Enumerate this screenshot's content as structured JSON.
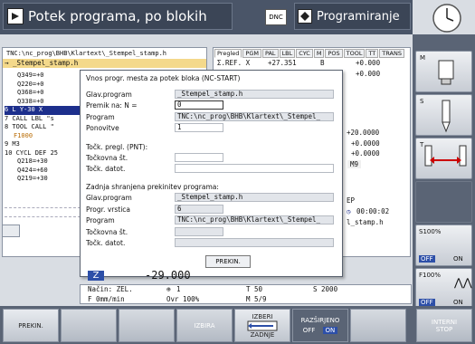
{
  "header": {
    "left_title": "Potek programa, po blokih",
    "dnc_label": "DNC",
    "right_title": "Programiranje"
  },
  "left_panel": {
    "path": "TNC:\\nc_prog\\BHB\\Klartext\\_Stempel_stamp.h",
    "active_file": "→ _Stempel_stamp.h",
    "lines": [
      "Q349=+0",
      "Q220=+0",
      "Q368=+0",
      "Q338=+0",
      "6  L  Y-30  X",
      "7  CALL LBL \"s",
      "8  TOOL CALL \"",
      "F1000",
      "9  M3",
      "10 CYCL DEF 25",
      "Q218=+30",
      "Q424=+60",
      "Q219=+30"
    ]
  },
  "right_panel": {
    "tabs": [
      "Pregled",
      "PGM",
      "PAL",
      "LBL",
      "CYC",
      "M",
      "POS",
      "TOOL",
      "TT",
      "TRANS"
    ],
    "row1": "Σ.REF. X",
    "row1_val": "+27.351",
    "row1_axis": "B",
    "row1_b": "+0.000",
    "row2_b": "+0.000",
    "val_a": "+20.0000",
    "val_b": "+0.0000",
    "val_c": "+0.0000",
    "m9": "M9",
    "time_label": "EP",
    "time": "00:00:02",
    "file": "l_stamp.h"
  },
  "dialog": {
    "title": "Vnos progr. mesta za potek bloka (NC-START)",
    "main_prog_label": "Glav.program",
    "main_prog_value": "_Stempel_stamp.h",
    "jump_label": "Premik na: N =",
    "jump_value": "0",
    "program_label": "Program",
    "program_value": "TNC:\\nc_prog\\BHB\\Klartext\\_Stempel_",
    "repeat_label": "Ponovitve",
    "repeat_value": "1",
    "pnt_heading": "Točk. pregl. (PNT):",
    "point_no_label": "Točkovna št.",
    "point_file_label": "Točk. datot.",
    "saved_heading": "Zadnja shranjena prekinitev programa:",
    "s_main_label": "Glav.program",
    "s_main_value": "_Stempel_stamp.h",
    "s_line_label": "Progr. vrstica",
    "s_line_value": "6",
    "s_prog_label": "Program",
    "s_prog_value": "TNC:\\nc_prog\\BHB\\Klartext\\_Stempel_",
    "s_point_label": "Točkovna št.",
    "s_file_label": "Točk. datot.",
    "button": "PREKIN."
  },
  "status": {
    "axis": "Z",
    "axis_value": "-29.000",
    "mode": "Način: ZEL.",
    "tool_cnt": "1",
    "tool": "T 50",
    "spindle": "S 2000",
    "feed": "F 0mm/min",
    "ovr": "Ovr 100%",
    "m": "M 5/9"
  },
  "right_softkeys": {
    "m_label": "M",
    "s_label": "S",
    "t_label": "T",
    "s_ovr": "S100%",
    "off1": "OFF",
    "on1": "ON",
    "f_ovr": "F100%",
    "off2": "OFF",
    "on2": "ON"
  },
  "bottom_softkeys": {
    "prekin": "PREKIN.",
    "izbira": "IZBIRA",
    "izberi": "IZBERI",
    "zadnje": "ZADNJE",
    "razsirjeno": "RAZŠIRJENO",
    "off": "OFF",
    "on": "ON",
    "interni": "INTERNI",
    "stop": "STOP"
  }
}
